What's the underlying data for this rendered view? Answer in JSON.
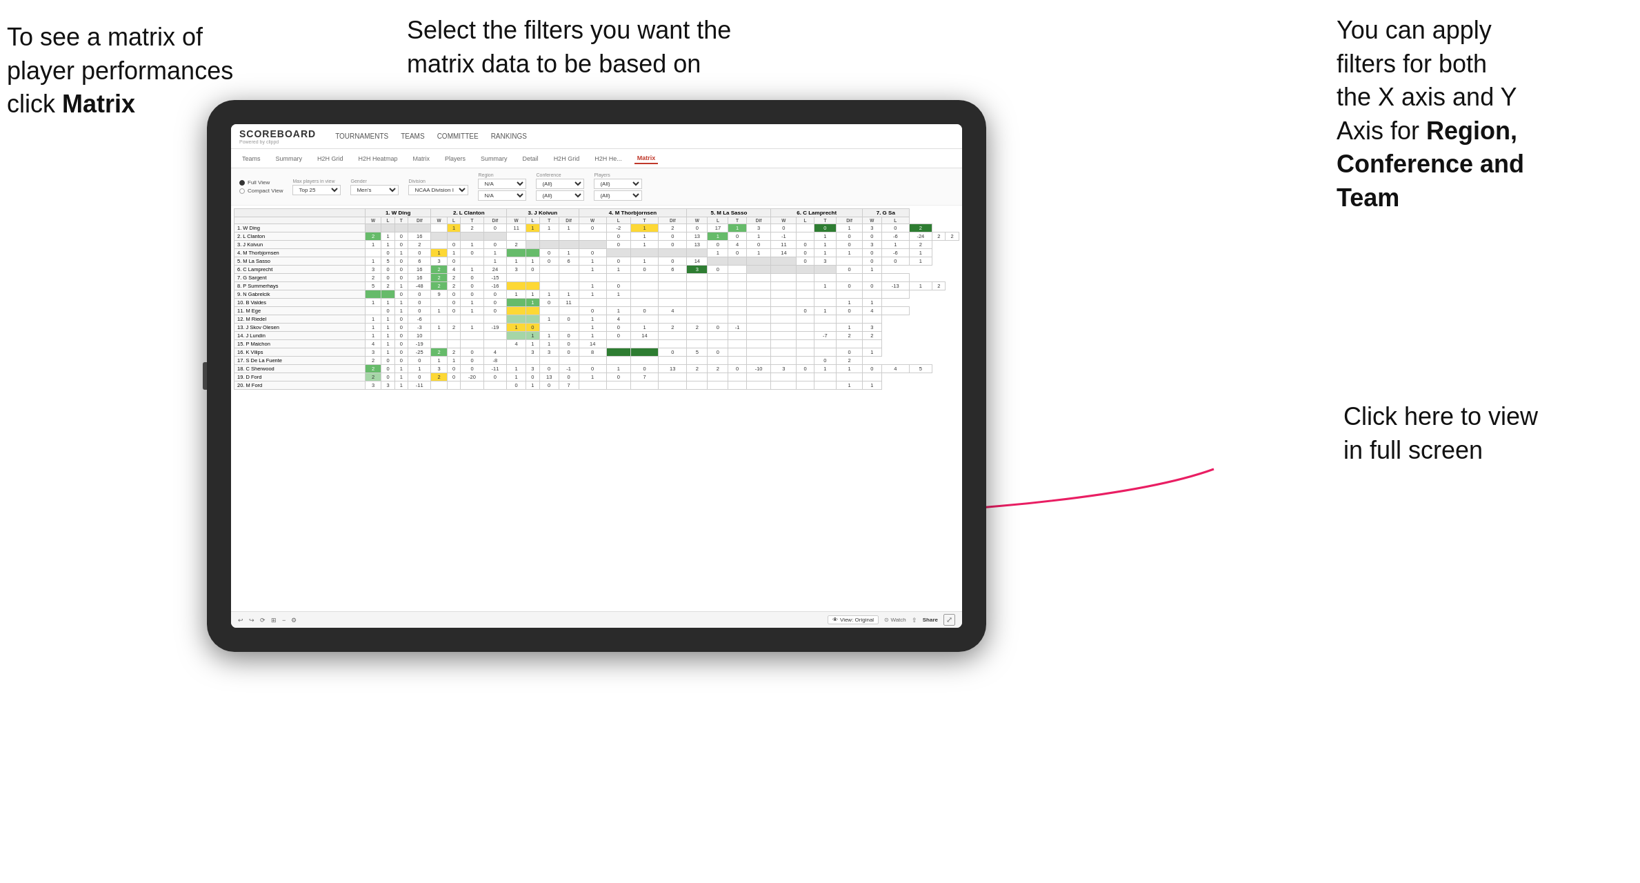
{
  "annotations": {
    "top_left": {
      "line1": "To see a matrix of",
      "line2": "player performances",
      "line3_plain": "click ",
      "line3_bold": "Matrix"
    },
    "top_center": {
      "text": "Select the filters you want the matrix data to be based on"
    },
    "top_right": {
      "line1": "You  can apply",
      "line2": "filters for both",
      "line3": "the X axis and Y",
      "line4_plain": "Axis for ",
      "line4_bold": "Region,",
      "line5_bold": "Conference and",
      "line6_bold": "Team"
    },
    "bottom_right": {
      "line1": "Click here to view",
      "line2": "in full screen"
    }
  },
  "app": {
    "logo_main": "SCOREBOARD",
    "logo_sub": "Powered by clippd",
    "nav": [
      "TOURNAMENTS",
      "TEAMS",
      "COMMITTEE",
      "RANKINGS"
    ],
    "sub_nav": [
      "Teams",
      "Summary",
      "H2H Grid",
      "H2H Heatmap",
      "Matrix",
      "Players",
      "Summary",
      "Detail",
      "H2H Grid",
      "H2H He...",
      "Matrix"
    ],
    "active_tab": "Matrix"
  },
  "filters": {
    "view_options": [
      "Full View",
      "Compact View"
    ],
    "active_view": "Full View",
    "max_players_label": "Max players in view",
    "max_players_value": "Top 25",
    "gender_label": "Gender",
    "gender_value": "Men's",
    "division_label": "Division",
    "division_value": "NCAA Division I",
    "region_label": "Region",
    "region_values": [
      "N/A",
      "N/A"
    ],
    "conference_label": "Conference",
    "conference_values": [
      "(All)",
      "(All)"
    ],
    "players_label": "Players",
    "players_values": [
      "(All)",
      "(All)"
    ]
  },
  "matrix": {
    "col_headers": [
      "1. W Ding",
      "2. L Clanton",
      "3. J Koivun",
      "4. M Thorbjornsen",
      "5. M La Sasso",
      "6. C Lamprecht",
      "7. G Sa"
    ],
    "sub_headers": [
      "W",
      "L",
      "T",
      "Dif"
    ],
    "rows": [
      {
        "name": "1. W Ding"
      },
      {
        "name": "2. L Clanton"
      },
      {
        "name": "3. J Koivun"
      },
      {
        "name": "4. M Thorbjornsen"
      },
      {
        "name": "5. M La Sasso"
      },
      {
        "name": "6. C Lamprecht"
      },
      {
        "name": "7. G Sargent"
      },
      {
        "name": "8. P Summerhays"
      },
      {
        "name": "9. N Gabrelcik"
      },
      {
        "name": "10. B Valdes"
      },
      {
        "name": "11. M Ege"
      },
      {
        "name": "12. M Riedel"
      },
      {
        "name": "13. J Skov Olesen"
      },
      {
        "name": "14. J Lundin"
      },
      {
        "name": "15. P Maichon"
      },
      {
        "name": "16. K Vilips"
      },
      {
        "name": "17. S De La Fuente"
      },
      {
        "name": "18. C Sherwood"
      },
      {
        "name": "19. D Ford"
      },
      {
        "name": "20. M Ford"
      }
    ]
  },
  "toolbar": {
    "view_original": "View: Original",
    "watch": "Watch",
    "share": "Share"
  }
}
